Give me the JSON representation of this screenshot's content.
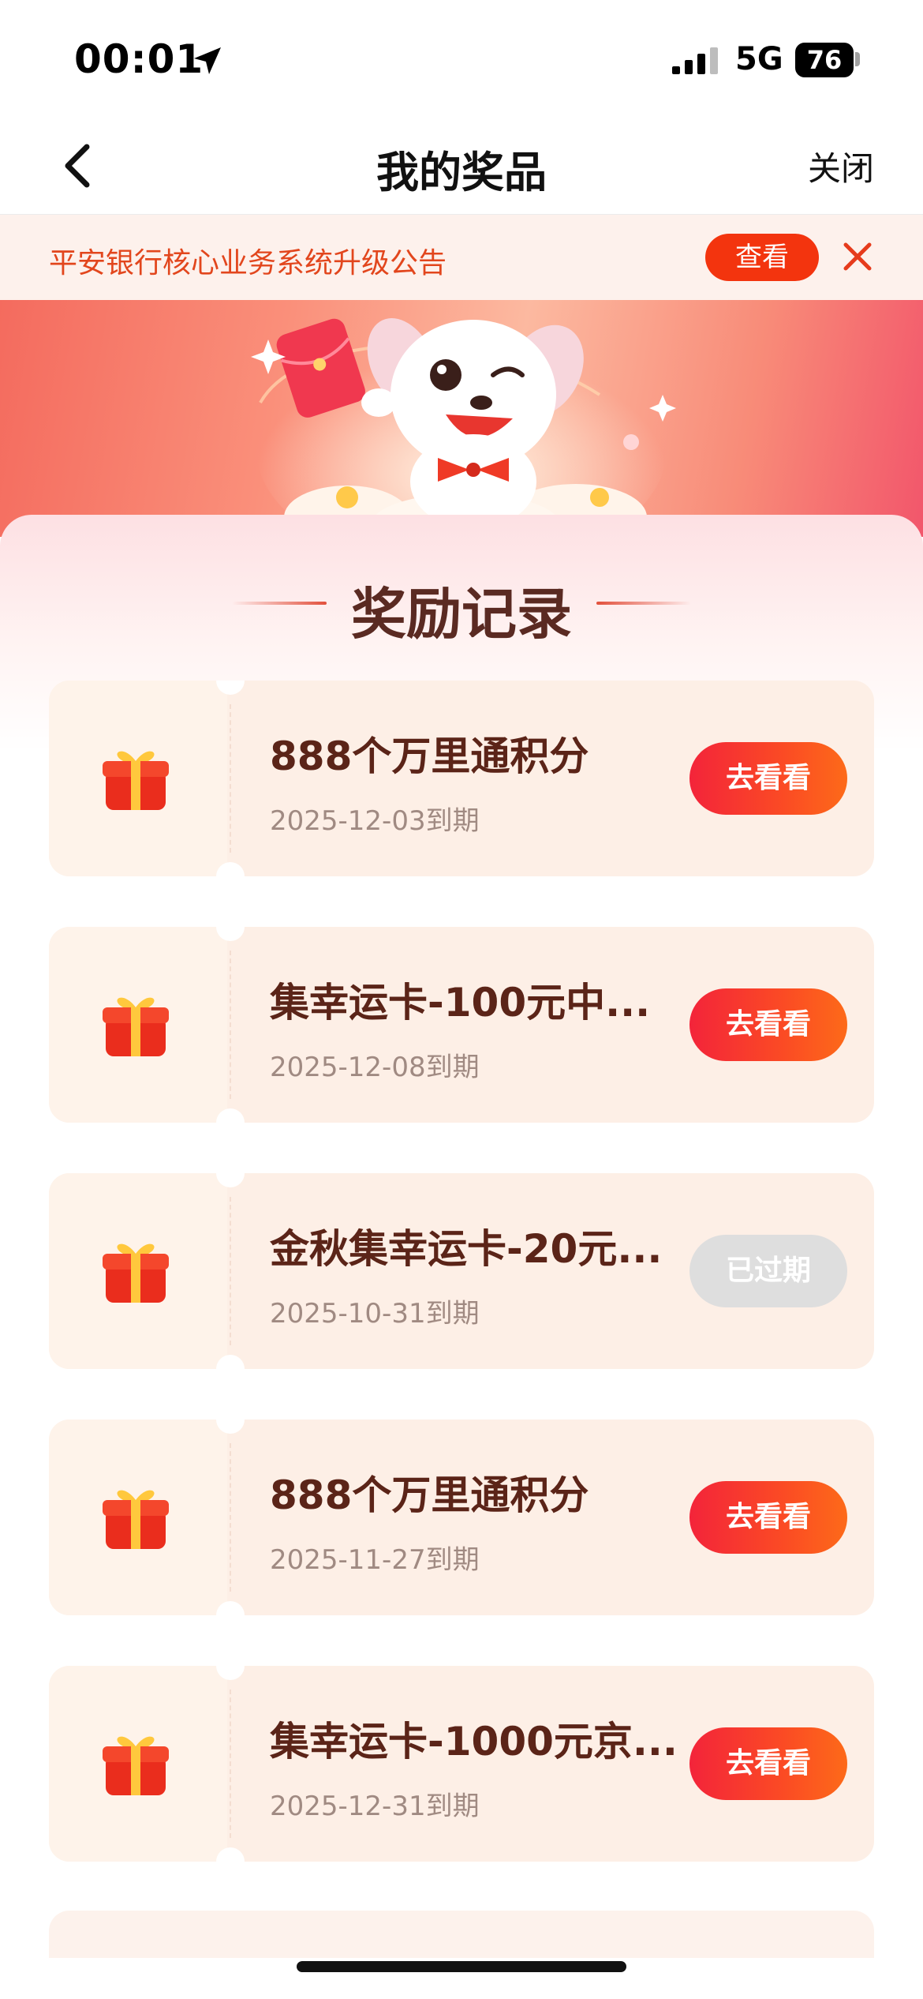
{
  "status_bar": {
    "time": "00:01",
    "network": "5G",
    "battery": "76"
  },
  "nav": {
    "title": "我的奖品",
    "close_label": "关闭"
  },
  "notice": {
    "text": "平安银行核心业务系统升级公告",
    "view_label": "查看"
  },
  "section": {
    "title": "奖励记录"
  },
  "colors": {
    "accent": "#f3340e",
    "button_gradient_start": "#f3243a",
    "button_gradient_end": "#fd6a19",
    "expired_button": "#dedede",
    "card_bg": "#fdefe6",
    "title_text": "#5b2418"
  },
  "rewards": [
    {
      "title": "888个万里通积分",
      "date": "2025-12-03到期",
      "button": "去看看",
      "status": "active"
    },
    {
      "title": "集幸运卡-100元中...",
      "date": "2025-12-08到期",
      "button": "去看看",
      "status": "active"
    },
    {
      "title": "金秋集幸运卡-20元...",
      "date": "2025-10-31到期",
      "button": "已过期",
      "status": "expired"
    },
    {
      "title": "888个万里通积分",
      "date": "2025-11-27到期",
      "button": "去看看",
      "status": "active"
    },
    {
      "title": "集幸运卡-1000元京...",
      "date": "2025-12-31到期",
      "button": "去看看",
      "status": "active"
    }
  ]
}
